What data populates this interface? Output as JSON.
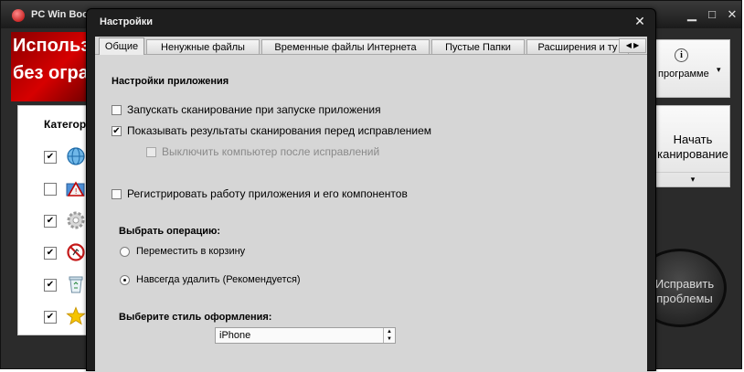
{
  "main_window": {
    "title": "PC Win Boo",
    "banner_line1": "Использу",
    "banner_line2": "без огран",
    "categories_header": "Категор",
    "category_rows": [
      {
        "checked": "✔",
        "icon": "globe-icon"
      },
      {
        "checked": "",
        "icon": "warning-folder-icon"
      },
      {
        "checked": "✔",
        "icon": "gear-icon"
      },
      {
        "checked": "✔",
        "icon": "no-entry-icon"
      },
      {
        "checked": "✔",
        "icon": "recycle-bin-icon"
      },
      {
        "checked": "✔",
        "icon": "star-icon"
      }
    ],
    "info_label": "программе",
    "info_icon": "i",
    "scan_label_line1": "Начать",
    "scan_label_line2": "канирование",
    "fix_label_line1": "Исправить",
    "fix_label_line2": "проблемы",
    "minimize_icon": "▁",
    "maximize_icon": "□",
    "close_icon": "✕",
    "dropdown_icon": "▾"
  },
  "dialog": {
    "title": "Настройки",
    "close_icon": "✕",
    "tabs": [
      {
        "label": "Общие",
        "active": true
      },
      {
        "label": "Ненужные файлы",
        "active": false
      },
      {
        "label": "Временные файлы Интернета",
        "active": false
      },
      {
        "label": "Пустые Папки",
        "active": false
      },
      {
        "label": "Расширения и ту",
        "active": false
      }
    ],
    "tab_scroll": "◀ ▶",
    "section_title": "Настройки приложения",
    "options": [
      {
        "label": "Запускать сканирование при запуске приложения",
        "checked": false,
        "mark": "",
        "enabled": true
      },
      {
        "label": "Показывать результаты сканирования перед исправлением",
        "checked": true,
        "mark": "✔",
        "enabled": true
      },
      {
        "label": "Выключить компьютер после исправлений",
        "checked": false,
        "mark": "",
        "enabled": false
      },
      {
        "label": "Регистрировать работу приложения и его компонентов",
        "checked": false,
        "mark": "",
        "enabled": true
      }
    ],
    "operation_title": "Выбрать операцию:",
    "operations": [
      {
        "label": "Переместить в корзину",
        "selected": false
      },
      {
        "label": "Навсегда удалить (Рекомендуется)",
        "selected": true
      }
    ],
    "style_title": "Выберите стиль оформления:",
    "style_value": "iPhone",
    "spin_up": "▲",
    "spin_down": "▼"
  },
  "colors": {
    "banner_red": "#d60000",
    "dialog_frame": "#1e1e1e",
    "dialog_body": "#d6d6d6"
  }
}
